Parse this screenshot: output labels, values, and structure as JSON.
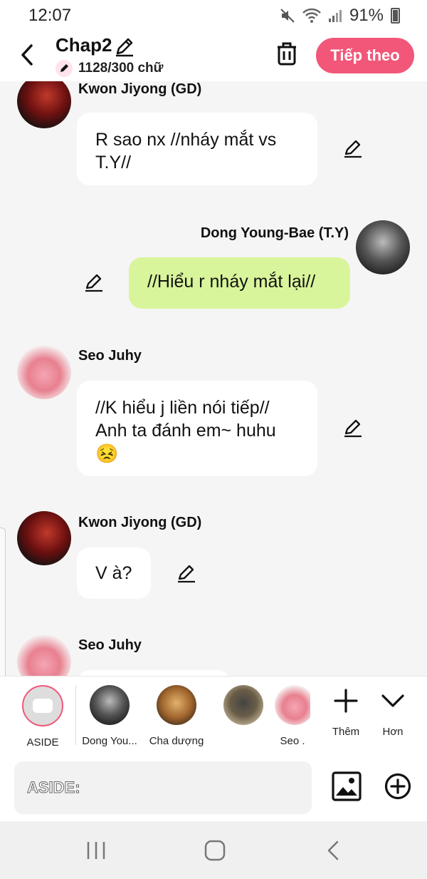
{
  "status": {
    "time": "12:07",
    "battery": "91%"
  },
  "header": {
    "title": "Chap2",
    "word_count": "1128/300 chữ",
    "next_label": "Tiếp theo"
  },
  "messages": [
    {
      "name": "Kwon Jiyong (GD)",
      "text": "R sao nx //nháy mắt vs T.Y//",
      "side": "left"
    },
    {
      "name": "Dong Young-Bae (T.Y)",
      "text": "//Hiểu r nháy mắt lại//",
      "side": "right"
    },
    {
      "name": "Seo Juhy",
      "text": "//K hiểu j liền nói tiếp//\nAnh ta đánh em~ huhu",
      "emoji": "😣",
      "side": "left"
    },
    {
      "name": "Kwon Jiyong (GD)",
      "text": "V à?",
      "side": "left"
    },
    {
      "name": "Seo Juhy",
      "text": "",
      "side": "left"
    }
  ],
  "characters": [
    {
      "label": "ASIDE"
    },
    {
      "label": "Dong You..."
    },
    {
      "label": "Cha dượng"
    },
    {
      "label": ""
    },
    {
      "label": "Seo ."
    }
  ],
  "tools": {
    "add_label": "Thêm",
    "more_label": "Hơn"
  },
  "input": {
    "placeholder": "ASIDE:"
  },
  "colors": {
    "accent": "#f25779",
    "right_bubble": "#d9f59b",
    "background": "#f5f5f5"
  }
}
